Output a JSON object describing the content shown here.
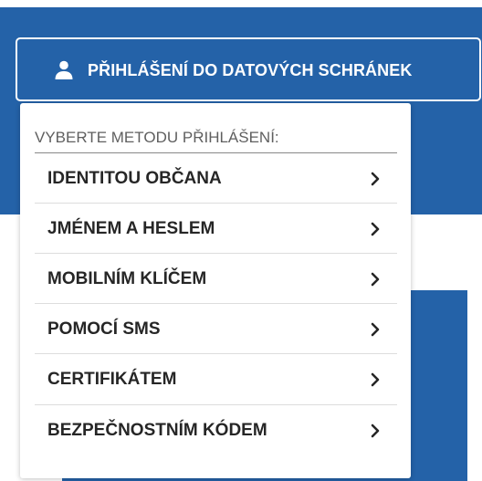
{
  "colors": {
    "brand_blue": "#2462a8",
    "white": "#ffffff",
    "item_text": "#262626",
    "heading_text": "#5f5f5f"
  },
  "login_button": {
    "label": "PŘIHLÁŠENÍ DO DATOVÝCH SCHRÁNEK",
    "icon": "person-icon"
  },
  "dropdown": {
    "heading": "VYBERTE METODU PŘIHLÁŠENÍ:",
    "items": [
      {
        "label": "IDENTITOU OBČANA",
        "icon": "chevron-right-icon"
      },
      {
        "label": "JMÉNEM A HESLEM",
        "icon": "chevron-right-icon"
      },
      {
        "label": "MOBILNÍM KLÍČEM",
        "icon": "chevron-right-icon"
      },
      {
        "label": "POMOCÍ SMS",
        "icon": "chevron-right-icon"
      },
      {
        "label": "CERTIFIKÁTEM",
        "icon": "chevron-right-icon"
      },
      {
        "label": "BEZPEČNOSTNÍM KÓDEM",
        "icon": "chevron-right-icon"
      }
    ]
  }
}
